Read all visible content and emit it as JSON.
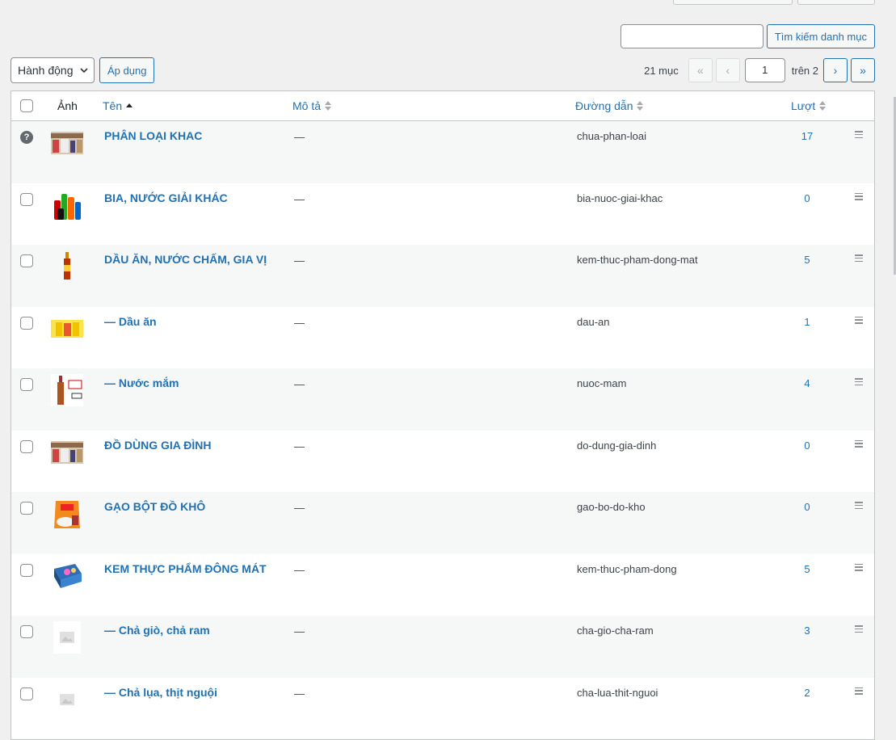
{
  "search": {
    "placeholder": "",
    "button_label": "Tìm kiếm danh mục"
  },
  "bulk": {
    "selected": "Hành động",
    "apply_label": "Áp dụng"
  },
  "pagination": {
    "count_text": "21 mục",
    "first": "«",
    "prev": "‹",
    "current": "1",
    "of_text": "trên 2",
    "next": "›",
    "last": "»"
  },
  "columns": {
    "image": "Ảnh",
    "name": "Tên",
    "description": "Mô tả",
    "slug": "Đường dẫn",
    "count": "Lượt"
  },
  "rows": [
    {
      "name": "PHÂN LOẠI KHAC",
      "description": "—",
      "slug": "chua-phan-loai",
      "count": "17",
      "thumb": "store-shelf",
      "uncategorized": true
    },
    {
      "name": "BIA, NƯỚC GIẢI KHÁC",
      "description": "—",
      "slug": "bia-nuoc-giai-khac",
      "count": "0",
      "thumb": "soda-cans"
    },
    {
      "name": "DẦU ĂN, NƯỚC CHẤM, GIA VỊ",
      "description": "—",
      "slug": "kem-thuc-pham-dong-mat",
      "count": "5",
      "thumb": "sauce-bottle"
    },
    {
      "name": "— Dầu ăn",
      "description": "—",
      "slug": "dau-an",
      "count": "1",
      "thumb": "oil-bottles"
    },
    {
      "name": "— Nước mắm",
      "description": "—",
      "slug": "nuoc-mam",
      "count": "4",
      "thumb": "fish-sauce"
    },
    {
      "name": "ĐỒ DÙNG GIA ĐÌNH",
      "description": "—",
      "slug": "do-dung-gia-dinh",
      "count": "0",
      "thumb": "store-shelf"
    },
    {
      "name": "GẠO BỘT ĐỒ KHÔ",
      "description": "—",
      "slug": "gao-bo-do-kho",
      "count": "0",
      "thumb": "rice-bag"
    },
    {
      "name": "KEM THỰC PHẨM ĐÔNG MÁT",
      "description": "—",
      "slug": "kem-thuc-pham-dong",
      "count": "5",
      "thumb": "ice-cream-box"
    },
    {
      "name": "— Chả giò, chả ram",
      "description": "—",
      "slug": "cha-gio-cha-ram",
      "count": "3",
      "thumb": "placeholder"
    },
    {
      "name": "— Chả lụa, thịt nguội",
      "description": "—",
      "slug": "cha-lua-thit-nguoi",
      "count": "2",
      "thumb": "placeholder"
    }
  ]
}
